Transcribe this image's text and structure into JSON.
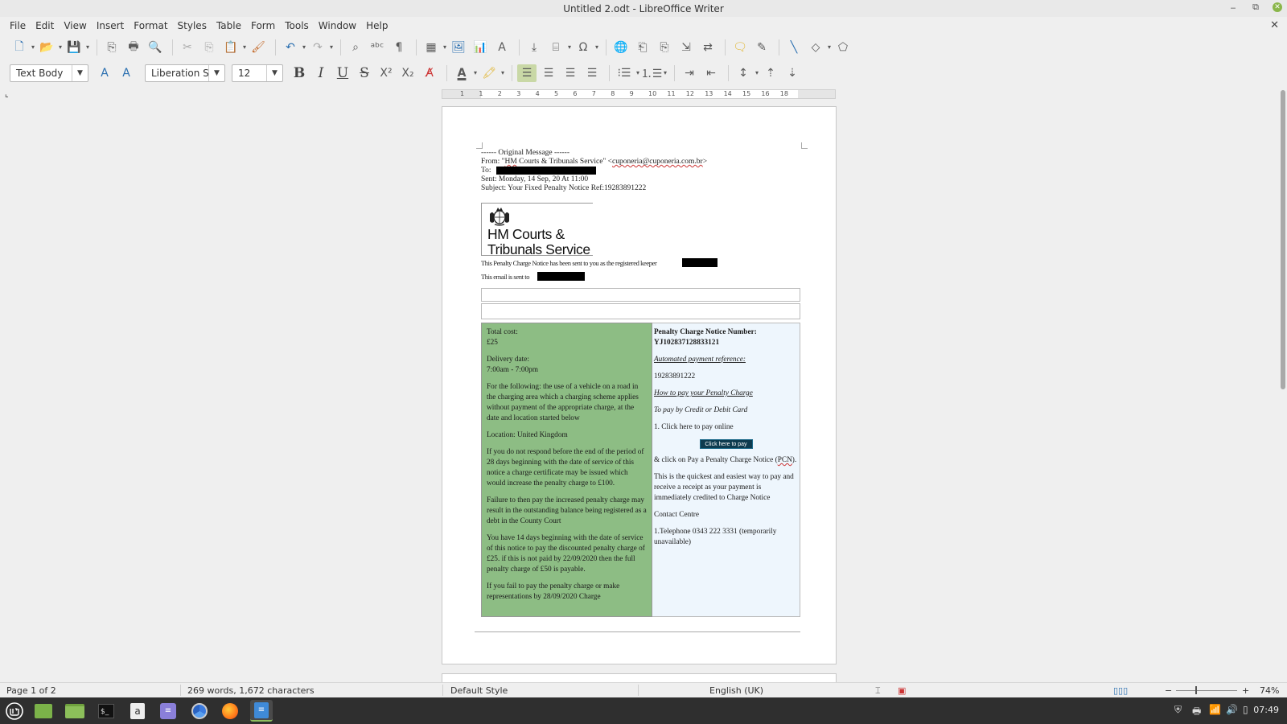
{
  "window": {
    "title": "Untitled 2.odt - LibreOffice Writer"
  },
  "menu": [
    "File",
    "Edit",
    "View",
    "Insert",
    "Format",
    "Styles",
    "Table",
    "Form",
    "Tools",
    "Window",
    "Help"
  ],
  "formatting": {
    "paragraph_style": "Text Body",
    "font_name": "Liberation S",
    "font_size": "12"
  },
  "ruler": {
    "ticks": [
      "1",
      "1",
      "2",
      "3",
      "4",
      "5",
      "6",
      "7",
      "8",
      "9",
      "10",
      "11",
      "12",
      "13",
      "14",
      "15",
      "16",
      "18"
    ]
  },
  "document": {
    "header_lines": {
      "line1": "------ Original Message ------",
      "from_prefix": "From: \"",
      "from_hm": "HM",
      "from_mid": " Courts & Tribunals Service\" <",
      "from_email": "cuponeria@cuponeria.com.br",
      "from_suffix": ">",
      "to": "To:",
      "sent": "Sent: Monday, 14 Sep, 20 At 11:00",
      "subject": "Subject: Your Fixed Penalty Notice Ref:19283891222"
    },
    "logo": {
      "line1": "HM Courts &",
      "line2": "Tribunals Service"
    },
    "notice_line1": "This Penalty Charge Notice has been sent to you as the registered keeper",
    "notice_line2": "This email is sent to",
    "left_col": {
      "total_cost_label": "Total cost:",
      "total_cost": "£25",
      "delivery_label": "Delivery date:",
      "delivery": "7:00am - 7:00pm",
      "reason": "For the following: the use of a vehicle on a road in the charging area which a charging scheme applies without payment of the appropriate charge, at the date and location started below",
      "location": "Location: United Kingdom",
      "respond": "If you do not respond before the end of the period of 28 days beginning with the date of service of this notice a charge certificate may be issued which would increase the penalty charge to £100.",
      "failure": "Failure to then pay the increased penalty charge may result in the outstanding balance being registered as a debt in the County Court",
      "fourteen_days": "You have 14 days beginning with the date of service of this notice to pay the discounted penalty charge of £25. if this is not paid by 22/09/2020 then the full penalty charge of £50 is payable.",
      "fail_pay": "If you fail to pay the penalty charge or make representations by 28/09/2020 Charge"
    },
    "right_col": {
      "pcn_label": "Penalty Charge Notice Number:",
      "pcn_number": "YJ102837128833121",
      "auto_ref_label": "Automated payment reference:",
      "auto_ref": "19283891222",
      "how_to_pay": "How to pay your Penalty Charge",
      "credit": "To pay by Credit or Debit Card",
      "click_here": "1. Click here to pay online",
      "pay_button": "Click here to pay",
      "click_on_pre": "& click on Pay a Penalty Charge Notice (",
      "click_on_pcn": "PCN",
      "click_on_post": ").",
      "quickest": "This is the quickest and easiest way to pay and receive a receipt as your payment is immediately credited to Charge Notice",
      "contact": "Contact Centre",
      "telephone": "1.Telephone 0343 222 3331 (temporarily unavailable)"
    }
  },
  "statusbar": {
    "page": "Page 1 of 2",
    "words": "269 words, 1,672 characters",
    "page_style": "Default Style",
    "language": "English (UK)",
    "zoom": "74%"
  },
  "taskbar": {
    "clock": "07:49"
  },
  "colors": {
    "green_cell": "#8dbd84",
    "blue_cell": "#eef6fd",
    "pay_button": "#0e3b4f"
  }
}
